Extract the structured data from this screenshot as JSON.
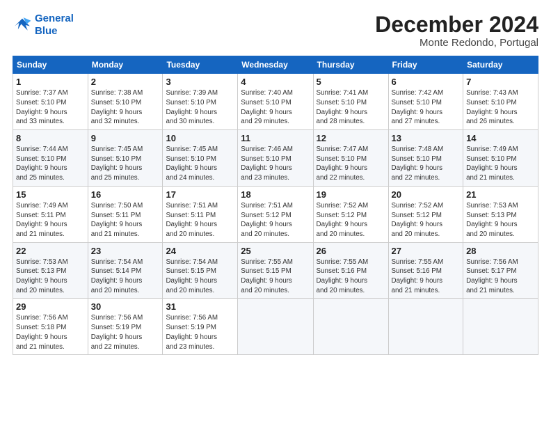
{
  "logo": {
    "line1": "General",
    "line2": "Blue"
  },
  "title": "December 2024",
  "location": "Monte Redondo, Portugal",
  "days_of_week": [
    "Sunday",
    "Monday",
    "Tuesday",
    "Wednesday",
    "Thursday",
    "Friday",
    "Saturday"
  ],
  "weeks": [
    [
      {
        "day": "1",
        "detail": "Sunrise: 7:37 AM\nSunset: 5:10 PM\nDaylight: 9 hours\nand 33 minutes."
      },
      {
        "day": "2",
        "detail": "Sunrise: 7:38 AM\nSunset: 5:10 PM\nDaylight: 9 hours\nand 32 minutes."
      },
      {
        "day": "3",
        "detail": "Sunrise: 7:39 AM\nSunset: 5:10 PM\nDaylight: 9 hours\nand 30 minutes."
      },
      {
        "day": "4",
        "detail": "Sunrise: 7:40 AM\nSunset: 5:10 PM\nDaylight: 9 hours\nand 29 minutes."
      },
      {
        "day": "5",
        "detail": "Sunrise: 7:41 AM\nSunset: 5:10 PM\nDaylight: 9 hours\nand 28 minutes."
      },
      {
        "day": "6",
        "detail": "Sunrise: 7:42 AM\nSunset: 5:10 PM\nDaylight: 9 hours\nand 27 minutes."
      },
      {
        "day": "7",
        "detail": "Sunrise: 7:43 AM\nSunset: 5:10 PM\nDaylight: 9 hours\nand 26 minutes."
      }
    ],
    [
      {
        "day": "8",
        "detail": "Sunrise: 7:44 AM\nSunset: 5:10 PM\nDaylight: 9 hours\nand 25 minutes."
      },
      {
        "day": "9",
        "detail": "Sunrise: 7:45 AM\nSunset: 5:10 PM\nDaylight: 9 hours\nand 25 minutes."
      },
      {
        "day": "10",
        "detail": "Sunrise: 7:45 AM\nSunset: 5:10 PM\nDaylight: 9 hours\nand 24 minutes."
      },
      {
        "day": "11",
        "detail": "Sunrise: 7:46 AM\nSunset: 5:10 PM\nDaylight: 9 hours\nand 23 minutes."
      },
      {
        "day": "12",
        "detail": "Sunrise: 7:47 AM\nSunset: 5:10 PM\nDaylight: 9 hours\nand 22 minutes."
      },
      {
        "day": "13",
        "detail": "Sunrise: 7:48 AM\nSunset: 5:10 PM\nDaylight: 9 hours\nand 22 minutes."
      },
      {
        "day": "14",
        "detail": "Sunrise: 7:49 AM\nSunset: 5:10 PM\nDaylight: 9 hours\nand 21 minutes."
      }
    ],
    [
      {
        "day": "15",
        "detail": "Sunrise: 7:49 AM\nSunset: 5:11 PM\nDaylight: 9 hours\nand 21 minutes."
      },
      {
        "day": "16",
        "detail": "Sunrise: 7:50 AM\nSunset: 5:11 PM\nDaylight: 9 hours\nand 21 minutes."
      },
      {
        "day": "17",
        "detail": "Sunrise: 7:51 AM\nSunset: 5:11 PM\nDaylight: 9 hours\nand 20 minutes."
      },
      {
        "day": "18",
        "detail": "Sunrise: 7:51 AM\nSunset: 5:12 PM\nDaylight: 9 hours\nand 20 minutes."
      },
      {
        "day": "19",
        "detail": "Sunrise: 7:52 AM\nSunset: 5:12 PM\nDaylight: 9 hours\nand 20 minutes."
      },
      {
        "day": "20",
        "detail": "Sunrise: 7:52 AM\nSunset: 5:12 PM\nDaylight: 9 hours\nand 20 minutes."
      },
      {
        "day": "21",
        "detail": "Sunrise: 7:53 AM\nSunset: 5:13 PM\nDaylight: 9 hours\nand 20 minutes."
      }
    ],
    [
      {
        "day": "22",
        "detail": "Sunrise: 7:53 AM\nSunset: 5:13 PM\nDaylight: 9 hours\nand 20 minutes."
      },
      {
        "day": "23",
        "detail": "Sunrise: 7:54 AM\nSunset: 5:14 PM\nDaylight: 9 hours\nand 20 minutes."
      },
      {
        "day": "24",
        "detail": "Sunrise: 7:54 AM\nSunset: 5:15 PM\nDaylight: 9 hours\nand 20 minutes."
      },
      {
        "day": "25",
        "detail": "Sunrise: 7:55 AM\nSunset: 5:15 PM\nDaylight: 9 hours\nand 20 minutes."
      },
      {
        "day": "26",
        "detail": "Sunrise: 7:55 AM\nSunset: 5:16 PM\nDaylight: 9 hours\nand 20 minutes."
      },
      {
        "day": "27",
        "detail": "Sunrise: 7:55 AM\nSunset: 5:16 PM\nDaylight: 9 hours\nand 21 minutes."
      },
      {
        "day": "28",
        "detail": "Sunrise: 7:56 AM\nSunset: 5:17 PM\nDaylight: 9 hours\nand 21 minutes."
      }
    ],
    [
      {
        "day": "29",
        "detail": "Sunrise: 7:56 AM\nSunset: 5:18 PM\nDaylight: 9 hours\nand 21 minutes."
      },
      {
        "day": "30",
        "detail": "Sunrise: 7:56 AM\nSunset: 5:19 PM\nDaylight: 9 hours\nand 22 minutes."
      },
      {
        "day": "31",
        "detail": "Sunrise: 7:56 AM\nSunset: 5:19 PM\nDaylight: 9 hours\nand 23 minutes."
      },
      null,
      null,
      null,
      null
    ]
  ]
}
